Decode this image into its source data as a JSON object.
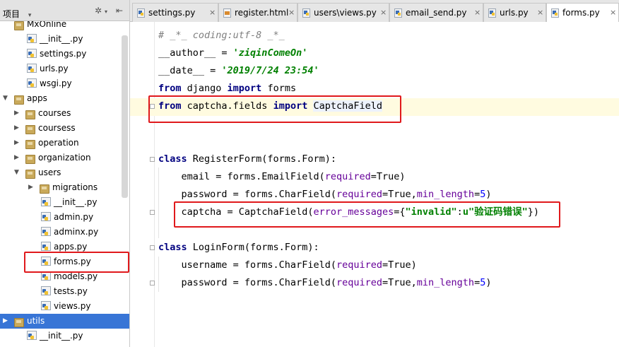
{
  "sidebar": {
    "title": "项目",
    "tree": [
      {
        "label": "MxOnline",
        "kind": "folder",
        "depth": 0,
        "arrow": ""
      },
      {
        "label": "__init__.py",
        "kind": "py",
        "depth": 1,
        "arrow": ""
      },
      {
        "label": "settings.py",
        "kind": "py",
        "depth": 1,
        "arrow": ""
      },
      {
        "label": "urls.py",
        "kind": "py",
        "depth": 1,
        "arrow": ""
      },
      {
        "label": "wsgi.py",
        "kind": "py",
        "depth": 1,
        "arrow": ""
      },
      {
        "label": "apps",
        "kind": "folder",
        "depth": 0,
        "arrow": "expanded"
      },
      {
        "label": "courses",
        "kind": "folder",
        "depth": 1,
        "arrow": "collapsed"
      },
      {
        "label": "coursess",
        "kind": "folder",
        "depth": 1,
        "arrow": "collapsed"
      },
      {
        "label": "operation",
        "kind": "folder",
        "depth": 1,
        "arrow": "collapsed"
      },
      {
        "label": "organization",
        "kind": "folder",
        "depth": 1,
        "arrow": "collapsed"
      },
      {
        "label": "users",
        "kind": "folder",
        "depth": 1,
        "arrow": "expanded"
      },
      {
        "label": "migrations",
        "kind": "folder",
        "depth": 2,
        "arrow": "collapsed"
      },
      {
        "label": "__init__.py",
        "kind": "py",
        "depth": 2,
        "arrow": ""
      },
      {
        "label": "admin.py",
        "kind": "py",
        "depth": 2,
        "arrow": ""
      },
      {
        "label": "adminx.py",
        "kind": "py",
        "depth": 2,
        "arrow": ""
      },
      {
        "label": "apps.py",
        "kind": "py",
        "depth": 2,
        "arrow": ""
      },
      {
        "label": "forms.py",
        "kind": "py",
        "depth": 2,
        "arrow": ""
      },
      {
        "label": "models.py",
        "kind": "py",
        "depth": 2,
        "arrow": ""
      },
      {
        "label": "tests.py",
        "kind": "py",
        "depth": 2,
        "arrow": ""
      },
      {
        "label": "views.py",
        "kind": "py",
        "depth": 2,
        "arrow": ""
      },
      {
        "label": "utils",
        "kind": "folder",
        "depth": 0,
        "arrow": "collapsed",
        "selected": true
      },
      {
        "label": "__init__.py",
        "kind": "py",
        "depth": 1,
        "arrow": ""
      }
    ]
  },
  "tabs": [
    {
      "label": "settings.py",
      "icon": "python-file-icon",
      "active": false
    },
    {
      "label": "register.html",
      "icon": "html-file-icon",
      "active": false
    },
    {
      "label": "users\\views.py",
      "icon": "python-file-icon",
      "active": false
    },
    {
      "label": "email_send.py",
      "icon": "python-file-icon",
      "active": false
    },
    {
      "label": "urls.py",
      "icon": "python-file-icon",
      "active": false
    },
    {
      "label": "forms.py",
      "icon": "python-file-icon",
      "active": true
    }
  ],
  "tab_close_glyph": "×",
  "code": {
    "l1": "# _*_ coding:utf-8 _*_",
    "l2a": "__author__",
    "l2b": " = ",
    "l2c": "'ziqinComeOn'",
    "l3a": "__date__",
    "l3b": " = ",
    "l3c": "'2019/7/24 23:54'",
    "l4a": "from",
    "l4b": " django ",
    "l4c": "import",
    "l4d": " forms",
    "l5a": "from",
    "l5b": " captcha.fields ",
    "l5c": "import",
    "l5e": " ",
    "l5d": "CaptchaField",
    "l8a": "class",
    "l8b": " RegisterForm(forms.Form):",
    "l9a": "    email = forms.EmailField(",
    "l9b": "required",
    "l9c": "=True)",
    "l10a": "    password = forms.CharField(",
    "l10b": "required",
    "l10c": "=True,",
    "l10d": "min_length",
    "l10e": "=",
    "l10f": "5",
    "l10g": ")",
    "l11a": "    captcha = CaptchaField(",
    "l11b": "error_messages",
    "l11c": "={",
    "l11d": "\"invalid\"",
    "l11e": ":",
    "l11f": "u\"验证码错误\"",
    "l11g": "})",
    "l13a": "class",
    "l13b": " LoginForm(forms.Form):",
    "l14a": "    username = forms.CharField(",
    "l14b": "required",
    "l14c": "=True)",
    "l15a": "    password = forms.CharField(",
    "l15b": "required",
    "l15c": "=True,",
    "l15d": "min_length",
    "l15e": "=",
    "l15f": "5",
    "l15g": ")"
  },
  "colors": {
    "keyword": "#000080",
    "string": "#008000",
    "kwarg": "#660099",
    "number": "#0000ff",
    "annotation_box": "#e0191c",
    "selection": "#3875d6"
  }
}
